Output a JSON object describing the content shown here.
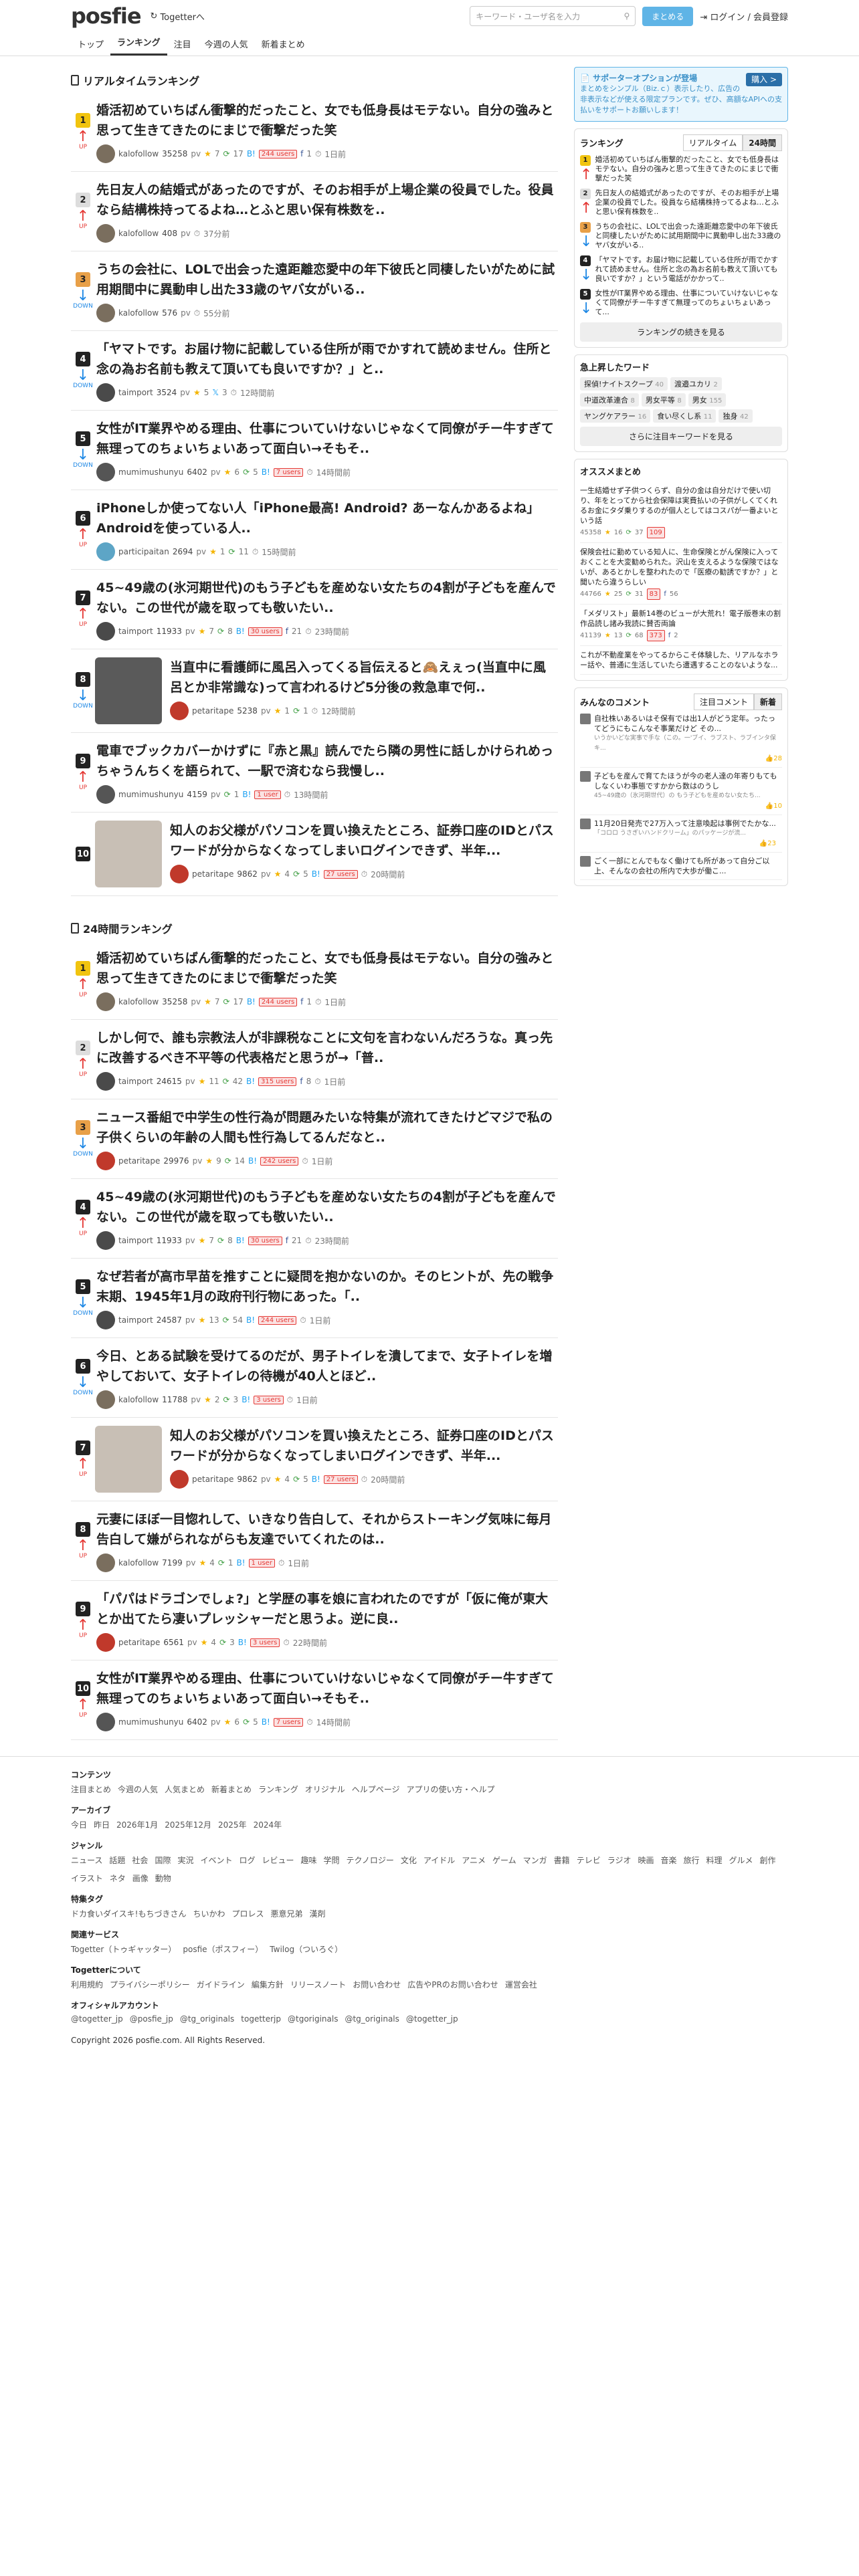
{
  "header": {
    "logo": "posfie",
    "tg_link": "Togetterへ",
    "search_placeholder": "キーワード・ユーザ名を入力",
    "btn_matome": "まとめる",
    "login": "ログイン / 会員登録"
  },
  "nav": [
    "トップ",
    "ランキング",
    "注目",
    "今週の人気",
    "新着まとめ"
  ],
  "realtime_title": "リアルタイムランキング",
  "realtime": [
    {
      "rank": "1",
      "dir": "UP",
      "title": "婚活初めていちばん衝撃的だったこと、女でも低身長はモテない。自分の強みと思って生きてきたのにまじで衝撃だった笑",
      "user": "kalofollow",
      "pv": "35258",
      "st": "7",
      "rt": "17",
      "users": "244 users",
      "fb": "1",
      "time": "1日前"
    },
    {
      "rank": "2",
      "dir": "UP",
      "title": "先日友人の結婚式があったのですが、そのお相手が上場企業の役員でした。役員なら結構株持ってるよね…とふと思い保有株数を..",
      "user": "kalofollow",
      "pv": "408",
      "time": "37分前"
    },
    {
      "rank": "3",
      "dir": "DOWN",
      "title": "うちの会社に、LOLで出会った遠距離恋愛中の年下彼氏と同棲したいがために試用期間中に異動申し出た33歳のヤバ女がいる..",
      "user": "kalofollow",
      "pv": "576",
      "time": "55分前"
    },
    {
      "rank": "4",
      "dir": "DOWN",
      "title": "「ヤマトです。お届け物に記載している住所が雨でかすれて読めません。住所と念の為お名前も教えて頂いても良いですか？」と..",
      "user": "taimport",
      "pv": "3524",
      "st": "5",
      "rt": "",
      "tw": "3",
      "time": "12時間前"
    },
    {
      "rank": "5",
      "dir": "DOWN",
      "title": "女性がIT業界やめる理由、仕事についていけないじゃなくて同僚がチー牛すぎて無理ってのちょいちょいあって面白い→そもそ..",
      "user": "mumimushunyu",
      "pv": "6402",
      "st": "6",
      "rt": "5",
      "users": "7 users",
      "time": "14時間前"
    },
    {
      "rank": "6",
      "dir": "UP",
      "title": "iPhoneしか使ってない人「iPhone最高! Android? あーなんかあるよね」Androidを使っている人..",
      "user": "participaitan",
      "pv": "2694",
      "st": "1",
      "rt": "11",
      "time": "15時間前"
    },
    {
      "rank": "7",
      "dir": "UP",
      "title": "45~49歳の(氷河期世代)のもう子どもを産めない女たちの4割が子どもを産んでない。この世代が歳を取っても敬いたい..",
      "user": "taimport",
      "pv": "11933",
      "st": "7",
      "rt": "8",
      "users": "30 users",
      "fb": "21",
      "time": "23時間前"
    },
    {
      "rank": "8",
      "dir": "DOWN",
      "title": "当直中に看護師に風呂入ってくる旨伝えると🙈えぇっ(当直中に風呂とか非常識な)って言われるけど5分後の救急車で何..",
      "user": "petaritape",
      "pv": "5238",
      "st": "1",
      "rt": "1",
      "time": "12時間前",
      "thumb": "1"
    },
    {
      "rank": "9",
      "dir": "UP",
      "title": "電車でブックカバーかけずに『赤と黒』読んでたら隣の男性に話しかけられめっちゃうんちくを語られて、一駅で済むなら我慢し..",
      "user": "mumimushunyu",
      "pv": "4159",
      "st": "",
      "rt": "1",
      "users": "1 user",
      "time": "13時間前"
    },
    {
      "rank": "10",
      "dir": "",
      "title": "知人のお父様がパソコンを買い換えたところ、証券口座のIDとパスワードが分からなくなってしまいログインできず、半年...",
      "user": "petaritape",
      "pv": "9862",
      "st": "4",
      "rt": "5",
      "users": "27 users",
      "time": "20時間前",
      "thumb": "2"
    }
  ],
  "daily_title": "24時間ランキング",
  "daily": [
    {
      "rank": "1",
      "dir": "UP",
      "title": "婚活初めていちばん衝撃的だったこと、女でも低身長はモテない。自分の強みと思って生きてきたのにまじで衝撃だった笑",
      "user": "kalofollow",
      "pv": "35258",
      "st": "7",
      "rt": "17",
      "users": "244 users",
      "fb": "1",
      "time": "1日前"
    },
    {
      "rank": "2",
      "dir": "UP",
      "title": "しかし何で、誰も宗教法人が非課税なことに文句を言わないんだろうな。真っ先に改善するべき不平等の代表格だと思うが→「普..",
      "user": "taimport",
      "pv": "24615",
      "st": "11",
      "rt": "42",
      "users": "315 users",
      "fb": "8",
      "time": "1日前"
    },
    {
      "rank": "3",
      "dir": "DOWN",
      "title": "ニュース番組で中学生の性行為が問題みたいな特集が流れてきたけどマジで私の子供くらいの年齢の人間も性行為してるんだなと..",
      "user": "petaritape",
      "pv": "29976",
      "st": "9",
      "rt": "14",
      "users": "242 users",
      "time": "1日前"
    },
    {
      "rank": "4",
      "dir": "UP",
      "title": "45~49歳の(氷河期世代)のもう子どもを産めない女たちの4割が子どもを産んでない。この世代が歳を取っても敬いたい..",
      "user": "taimport",
      "pv": "11933",
      "st": "7",
      "rt": "8",
      "users": "30 users",
      "fb": "21",
      "time": "23時間前"
    },
    {
      "rank": "5",
      "dir": "DOWN",
      "title": "なぜ若者が高市早苗を推すことに疑問を抱かないのか。そのヒントが、先の戦争末期、1945年1月の政府刊行物にあった。「..",
      "user": "taimport",
      "pv": "24587",
      "st": "13",
      "rt": "54",
      "users": "244 users",
      "time": "1日前"
    },
    {
      "rank": "6",
      "dir": "DOWN",
      "title": "今日、とある試験を受けてるのだが、男子トイレを潰してまで、女子トイレを増やしておいて、女子トイレの待機が40人とほど..",
      "user": "kalofollow",
      "pv": "11788",
      "st": "2",
      "rt": "3",
      "users": "3 users",
      "time": "1日前"
    },
    {
      "rank": "7",
      "dir": "UP",
      "title": "知人のお父様がパソコンを買い換えたところ、証券口座のIDとパスワードが分からなくなってしまいログインできず、半年...",
      "user": "petaritape",
      "pv": "9862",
      "st": "4",
      "rt": "5",
      "users": "27 users",
      "time": "20時間前",
      "thumb": "2"
    },
    {
      "rank": "8",
      "dir": "UP",
      "title": "元妻にほぼ一目惚れして、いきなり告白して、それからストーキング気味に毎月告白して嫌がられながらも友達でいてくれたのは..",
      "user": "kalofollow",
      "pv": "7199",
      "st": "4",
      "rt": "1",
      "users": "1 user",
      "time": "1日前"
    },
    {
      "rank": "9",
      "dir": "UP",
      "title": "「パパはドラゴンでしょ?」と学歴の事を娘に言われたのですが「仮に俺が東大とか出てたら凄いプレッシャーだと思うよ。逆に良..",
      "user": "petaritape",
      "pv": "6561",
      "st": "4",
      "rt": "3",
      "users": "3 users",
      "time": "22時間前"
    },
    {
      "rank": "10",
      "dir": "UP",
      "title": "女性がIT業界やめる理由、仕事についていけないじゃなくて同僚がチー牛すぎて無理ってのちょいちょいあって面白い→そもそ..",
      "user": "mumimushunyu",
      "pv": "6402",
      "st": "6",
      "rt": "5",
      "users": "7 users",
      "time": "14時間前"
    }
  ],
  "side": {
    "support_title": "サポーターオプションが登場",
    "support_btn": "購入 >",
    "support_text": "まとめをシンプル（Biz.ｃ）表示したり、広告の非表示などが使える限定プランです。ぜひ、高額なAPIへの支払いをサポートお願いします！",
    "ranking_title": "ランキング",
    "tab_realtime": "リアルタイム",
    "tab_24": "24時間",
    "rk_items": [
      "婚活初めていちばん衝撃的だったこと、女でも低身長はモテない。自分の強みと思って生きてきたのにまじで衝撃だった笑",
      "先日友人の結婚式があったのですが、そのお相手が上場企業の役員でした。役員なら結構株持ってるよね…とふと思い保有株数を..",
      "うちの会社に、LOLで出会った遠距離恋愛中の年下彼氏と同棲したいがために試用期間中に異動申し出た33歳のヤバ女がいる..",
      "「ヤマトです。お届け物に記載している住所が雨でかすれて読めません。住所と念の為お名前も教えて頂いても良いですか？」という電話がかかって..",
      "女性がIT業界やめる理由、仕事についていけないじゃなくて同僚がチー牛すぎて無理ってのちょいちょいあって..."
    ],
    "rk_btn": "ランキングの続きを見る",
    "kw_title": "急上昇したワード",
    "kws": [
      [
        "探偵!ナイトスクープ",
        "40"
      ],
      [
        "渡邉ユカリ",
        "2"
      ],
      [
        "中道改革連合",
        "8"
      ],
      [
        "男女平等",
        "8"
      ],
      [
        "男女",
        "155"
      ],
      [
        "ヤングケアラー",
        "16"
      ],
      [
        "食い尽くし系",
        "11"
      ],
      [
        "独身",
        "42"
      ]
    ],
    "kw_btn": "さらに注目キーワードを見る",
    "os_title": "オススメまとめ",
    "os": [
      [
        "一生結婚せず子供つくらず、自分の金は自分だけで使い切り、年をとってから社会保障は実費払いの子供がしくてくれるお金にタダ乗りするのが個人としてはコスパが一番よいという話",
        "45358",
        "16",
        "37",
        "109"
      ],
      [
        "保険会社に勤めている知人に、生命保険とがん保険に入っておくことを大変勧められた。沢山を支えるような保険ではないが、あるとかしを整われたので「医療の勧誘ですか？」と聞いたら違うらしい",
        "44766",
        "25",
        "31",
        "83",
        "56"
      ],
      [
        "「メダリスト」最新14巻のビューが大荒れ！電子版巻末の割作品読し諸み我読に賛否両論",
        "41139",
        "13",
        "68",
        "373",
        "2"
      ],
      [
        "これが不動産業をやってるからこそ体験した、リアルなホラー話や、普通に生活していたら遭遇することのないような..."
      ]
    ],
    "cm_title": "みんなのコメント",
    "cm_tab1": "注目コメント",
    "cm_tab2": "新着",
    "cms": [
      [
        "自社株いあるいはそ保有では出1人がどう定年。ったってどうにもこんなそ事業だけど その...",
        "いうかいどな実事で手な（この。一'ブイ、ラブスト、ラブインタ保 キ...",
        "28"
      ],
      [
        "子どもを産んで育てたほうが今の老人達の年寄りもてもしなくいわ事態ですかから数はのうし",
        "45~49歳の（氷河期世代）の もう子どもを産めない女たち...",
        "10"
      ],
      [
        "11月20日発売で27万入って注意喚起は事例でたかな...",
        "「コロロ うさぎいハンドクリーム」のパッケージが流...",
        "23"
      ],
      [
        "ごく一部にとんでもなく働けても所があって自分ご以上、そんなの会社の所内で大歩が働こ..."
      ]
    ]
  },
  "footer": {
    "contents_h": "コンテンツ",
    "contents": [
      "注目まとめ",
      "今週の人気",
      "人気まとめ",
      "新着まとめ",
      "ランキング",
      "オリジナル",
      "ヘルプページ",
      "アプリの使い方・ヘルプ"
    ],
    "archive_h": "アーカイブ",
    "archive": [
      "今日",
      "昨日",
      "2026年1月",
      "2025年12月",
      "2025年",
      "2024年"
    ],
    "genre_h": "ジャンル",
    "genre": [
      "ニュース",
      "話題",
      "社会",
      "国際",
      "実況",
      "イベント",
      "ログ",
      "レビュー",
      "趣味",
      "学問",
      "テクノロジー",
      "文化",
      "アイドル",
      "アニメ",
      "ゲーム",
      "マンガ",
      "書籍",
      "テレビ",
      "ラジオ",
      "映画",
      "音楽",
      "旅行",
      "料理",
      "グルメ",
      "創作",
      "イラスト",
      "ネタ",
      "画像",
      "動物"
    ],
    "tags_h": "特集タグ",
    "tags": [
      "ドカ食いダイスキ!もちづきさん",
      "ちいかわ",
      "プロレス",
      "悪意兄弟",
      "漢剤"
    ],
    "svc_h": "関連サービス",
    "svc": [
      "Togetter（トゥギャッター）",
      "posfie（ポスフィー）",
      "Twilog（ついろぐ）"
    ],
    "about_h": "Togetterについて",
    "about": [
      "利用規約",
      "プライバシーポリシー",
      "ガイドライン",
      "編集方針",
      "リリースノート",
      "お問い合わせ",
      "広告やPRのお問い合わせ",
      "運営会社"
    ],
    "official_h": "オフィシャルアカウント",
    "official": [
      "@togetter_jp",
      "@posfie_jp",
      "@tg_originals",
      "togetterjp",
      "@tgoriginals",
      "@tg_originals",
      "@togetter_jp"
    ],
    "copy": "Copyright 2026 posfie.com. All Rights Reserved."
  }
}
